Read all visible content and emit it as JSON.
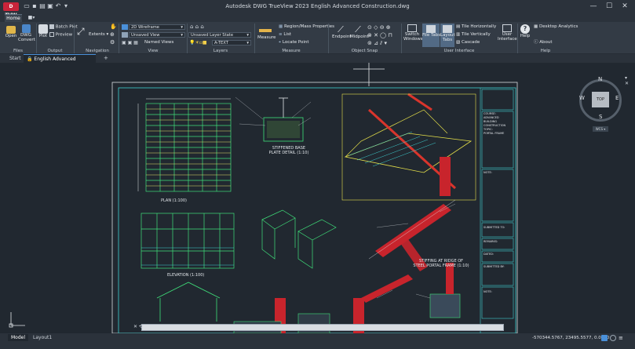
{
  "title_bar": {
    "app_badge": "D TVW",
    "title": "Autodesk DWG TrueView 2023    English Advanced Construction.dwg",
    "minimize": "—",
    "maximize": "☐",
    "close": "✕"
  },
  "ribbon_tabs": {
    "home": "Home"
  },
  "ribbon": {
    "files": {
      "panel_title": "Files",
      "open": "Open",
      "dwg_convert_1": "DWG",
      "dwg_convert_2": "Convert"
    },
    "output": {
      "panel_title": "Output",
      "plot": "Plot",
      "batch_plot": "Batch Plot",
      "preview": "Preview"
    },
    "navigation": {
      "panel_title": "Navigation",
      "extents": "Extents"
    },
    "view": {
      "panel_title": "View",
      "visual_style": "2D Wireframe",
      "named_view": "Unsaved View",
      "named_views": "Named Views"
    },
    "layers": {
      "panel_title": "Layers",
      "layer_state": "Unsaved Layer State",
      "current_layer": "A-TEXT"
    },
    "measure": {
      "panel_title": "Measure",
      "measure": "Measure",
      "region_mass": "Region/Mass Properties",
      "list": "List",
      "locate_point": "Locate Point"
    },
    "object_snap": {
      "panel_title": "Object Snap",
      "endpoint": "Endpoint",
      "midpoint": "Midpoint"
    },
    "user_interface": {
      "panel_title": "User Interface",
      "switch_windows_1": "Switch",
      "switch_windows_2": "Windows",
      "file_tabs": "File Tabs",
      "layout_tabs_1": "Layout",
      "layout_tabs_2": "Tabs",
      "tile_horizontally": "Tile Horizontally",
      "tile_vertically": "Tile Vertically",
      "cascade": "Cascade",
      "user_interface_1": "User",
      "user_interface_2": "Interface"
    },
    "help": {
      "panel_title": "Help",
      "help": "Help",
      "desktop_analytics": "Desktop Analytics",
      "about": "About"
    }
  },
  "file_tabs": {
    "start": "Start",
    "document": "English Advanced Construction",
    "new_tab": "+"
  },
  "viewcube": {
    "north": "N",
    "south": "S",
    "east": "E",
    "west": "W",
    "top": "TOP",
    "wcs": "WCS ▾"
  },
  "drawing": {
    "plan_label": "PLAN  (1:100)",
    "elevation_label": "ELEVATION  (1:100)",
    "base_plate_1": "STIFFENED BASE",
    "base_plate_2": "PLATE DETAIL (1:10)",
    "stiffing_1": "STIFFING AT RIDGE OF",
    "stiffing_2": "STEEL PORTAL FRAME  (1:10)",
    "title_block": [
      "COURSE:",
      "ADVANCED BUILDING CONSTRUCTION",
      "TOPIC:",
      "PORTAL FRAME",
      "NOTE:",
      "SUBMITTED TO:",
      "REMARKS:",
      "DATED:",
      "SUBMITTED BY:",
      "NOTE:"
    ]
  },
  "layout_tabs": {
    "model": "Model",
    "layout1": "Layout1"
  },
  "status_bar": {
    "coordinates": "-570344.5767, 23495.5577, 0.0000"
  },
  "colors": {
    "canvas": "#212830",
    "ribbon": "#333b45",
    "accent": "#4a90d9",
    "app_badge": "#c8243a"
  }
}
